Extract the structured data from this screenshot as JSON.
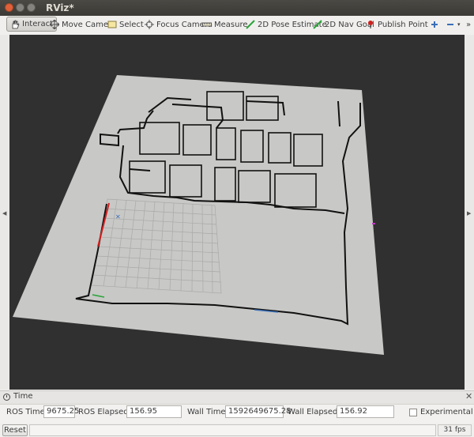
{
  "window": {
    "title": "RViz*"
  },
  "toolbar": {
    "tools": [
      {
        "label": "Interact",
        "icon": "hand-icon",
        "active": true
      },
      {
        "label": "Move Camera",
        "icon": "move-camera-icon"
      },
      {
        "label": "Select",
        "icon": "select-icon"
      },
      {
        "label": "Focus Camera",
        "icon": "focus-camera-icon"
      },
      {
        "label": "Measure",
        "icon": "ruler-icon"
      },
      {
        "label": "2D Pose Estimate",
        "icon": "green-arrow-icon"
      },
      {
        "label": "2D Nav Goal",
        "icon": "green-arrow-icon"
      },
      {
        "label": "Publish Point",
        "icon": "red-pin-icon"
      }
    ],
    "overflow": "»"
  },
  "time_panel": {
    "title": "Time",
    "ros_time_label": "ROS Time:",
    "ros_time": "9675.25",
    "ros_elapsed_label": "ROS Elapsed:",
    "ros_elapsed": "156.95",
    "wall_time_label": "Wall Time:",
    "wall_time": "1592649675.28",
    "wall_elapsed_label": "Wall Elapsed:",
    "wall_elapsed": "156.92",
    "experimental_label": "Experimental"
  },
  "status": {
    "reset_label": "Reset",
    "fps": "31 fps"
  },
  "colors": {
    "viewport_bg": "#303030",
    "map_free": "#c8c8c6",
    "grid": "#a6a6a6",
    "accent_red": "#d0201e"
  }
}
